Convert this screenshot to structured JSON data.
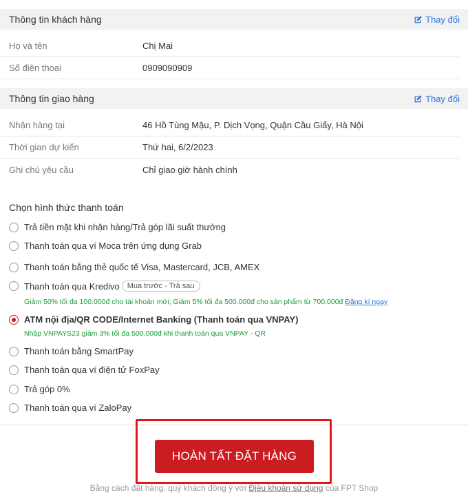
{
  "customer": {
    "title": "Thông tin khách hàng",
    "change_label": "Thay đổi",
    "rows": [
      {
        "label": "Họ và tên",
        "value": "Chị Mai"
      },
      {
        "label": "Số điện thoại",
        "value": "0909090909"
      }
    ]
  },
  "shipping": {
    "title": "Thông tin giao hàng",
    "change_label": "Thay đổi",
    "rows": [
      {
        "label": "Nhận hàng tại",
        "value": "46 Hồ Tùng Mậu, P. Dịch Vọng, Quận Cầu Giấy, Hà Nội"
      },
      {
        "label": "Thời gian dự kiến",
        "value": "Thứ hai, 6/2/2023"
      },
      {
        "label": "Ghi chú yêu cầu",
        "value": "Chỉ giao giờ hành chính"
      }
    ]
  },
  "payment": {
    "title": "Chọn hình thức thanh toán",
    "options": [
      {
        "label": "Trả tiền mặt khi nhận hàng/Trả góp lãi suất thường",
        "selected": false
      },
      {
        "label": "Thanh toán qua ví Moca trên ứng dụng Grab",
        "selected": false
      },
      {
        "label": "Thanh toán bằng thẻ quốc tế Visa, Mastercard, JCB, AMEX",
        "selected": false
      },
      {
        "label": "Thanh toán qua Kredivo",
        "badge": "Mua trước - Trả sau",
        "selected": false
      },
      {
        "label": "ATM nội địa/QR CODE/Internet Banking (Thanh toán qua VNPAY)",
        "selected": true
      },
      {
        "label": "Thanh toán bằng SmartPay",
        "selected": false
      },
      {
        "label": "Thanh toán qua ví điện tử FoxPay",
        "selected": false
      },
      {
        "label": "Trả góp 0%",
        "selected": false
      },
      {
        "label": "Thanh toán qua ví ZaloPay",
        "selected": false
      }
    ],
    "kredivo_promo": "Giảm 50% tối đa 100.000đ cho tài khoản mới; Giảm 5% tối đa 500.000đ cho sản phẩm từ 700.000đ",
    "kredivo_promo_link": "Đăng kí ngay",
    "vnpay_promo": "Nhập VNPAYS23 giảm 3% tối đa 500.000đ khi thanh toán qua VNPAY - QR"
  },
  "submit_label": "HOÀN TẤT ĐẶT HÀNG",
  "footer": {
    "prefix": "Bằng cách đặt hàng, quý khách đồng ý với",
    "link": "Điều khoản sử dụng",
    "suffix": "của FPT Shop"
  },
  "colors": {
    "accent": "#cb1c22",
    "link": "#2f73d8",
    "promo": "#1a9b3b"
  }
}
